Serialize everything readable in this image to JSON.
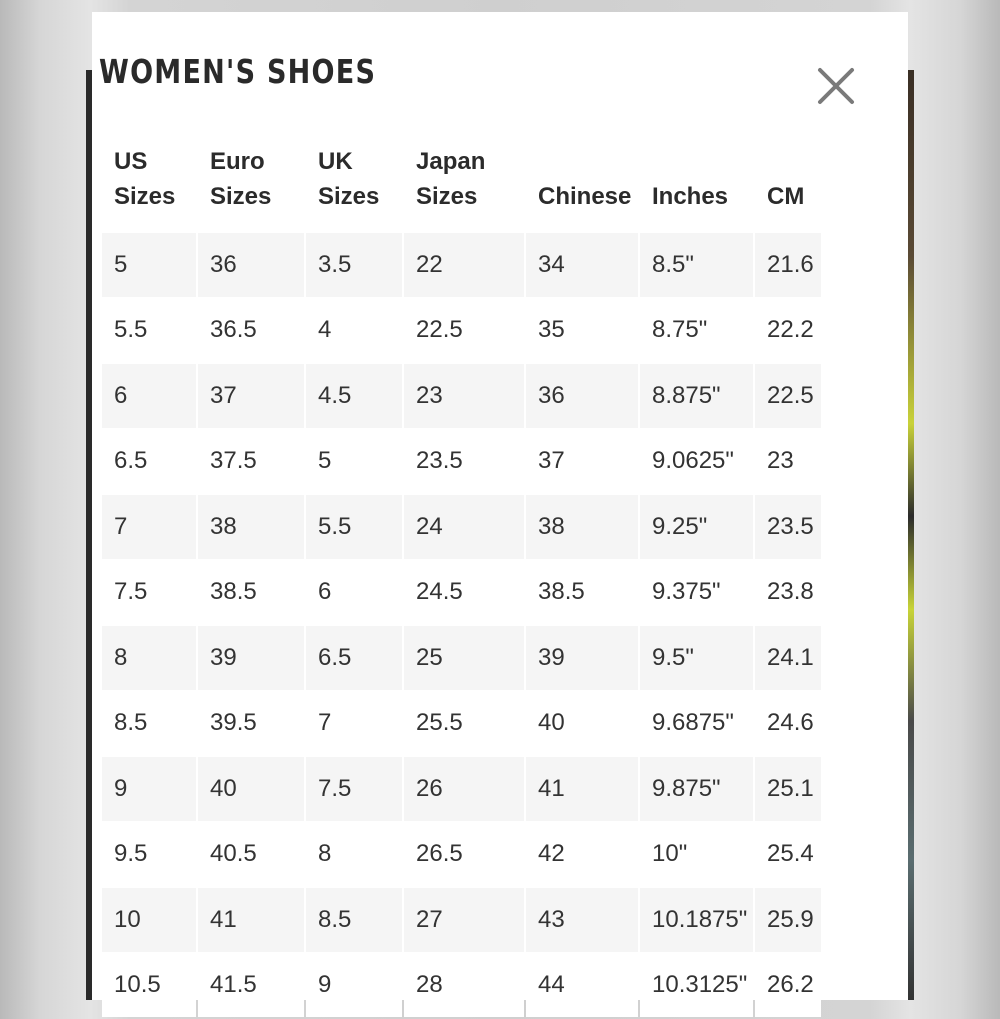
{
  "title": "WOMEN'S SHOES",
  "close_icon": "close-icon",
  "headers": [
    "US\nSizes",
    "Euro\nSizes",
    "UK\nSizes",
    "Japan\nSizes",
    "Chinese",
    "Inches",
    "CM"
  ],
  "rows": [
    [
      "5",
      "36",
      "3.5",
      "22",
      "34",
      "8.5\"",
      "21.6"
    ],
    [
      "5.5",
      "36.5",
      "4",
      "22.5",
      "35",
      "8.75\"",
      "22.2"
    ],
    [
      "6",
      "37",
      "4.5",
      "23",
      "36",
      "8.875\"",
      "22.5"
    ],
    [
      "6.5",
      "37.5",
      "5",
      "23.5",
      "37",
      "9.0625\"",
      "23"
    ],
    [
      "7",
      "38",
      "5.5",
      "24",
      "38",
      "9.25\"",
      "23.5"
    ],
    [
      "7.5",
      "38.5",
      "6",
      "24.5",
      "38.5",
      "9.375\"",
      "23.8"
    ],
    [
      "8",
      "39",
      "6.5",
      "25",
      "39",
      "9.5\"",
      "24.1"
    ],
    [
      "8.5",
      "39.5",
      "7",
      "25.5",
      "40",
      "9.6875\"",
      "24.6"
    ],
    [
      "9",
      "40",
      "7.5",
      "26",
      "41",
      "9.875\"",
      "25.1"
    ],
    [
      "9.5",
      "40.5",
      "8",
      "26.5",
      "42",
      "10\"",
      "25.4"
    ],
    [
      "10",
      "41",
      "8.5",
      "27",
      "43",
      "10.1875\"",
      "25.9"
    ],
    [
      "10.5",
      "41.5",
      "9",
      "28",
      "44",
      "10.3125\"",
      "26.2"
    ]
  ]
}
